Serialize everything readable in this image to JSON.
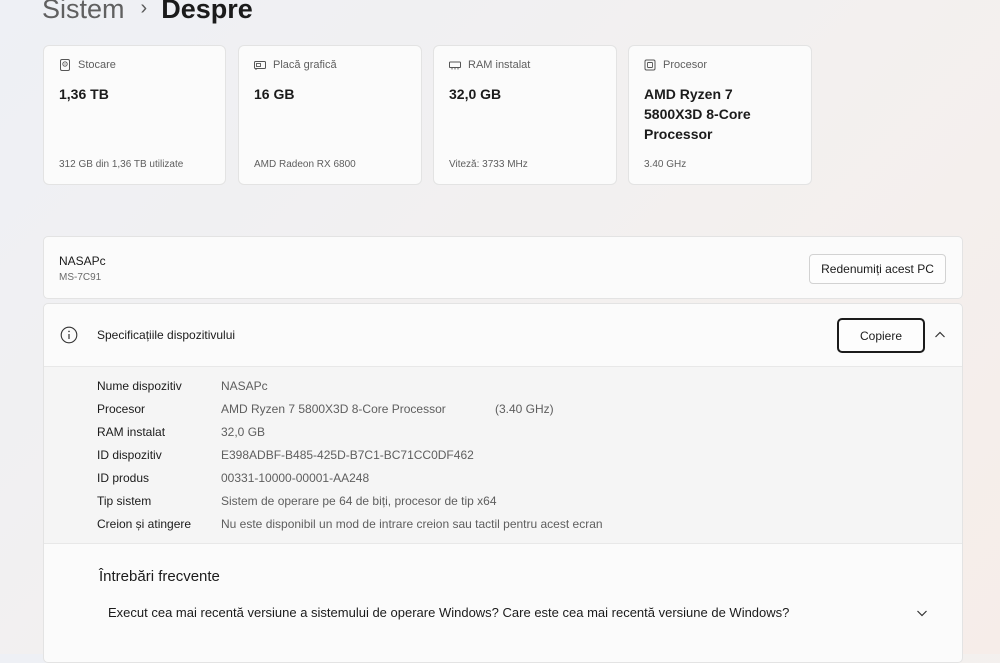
{
  "breadcrumb": {
    "parent": "Sistem",
    "separator": "›",
    "current": "Despre"
  },
  "cards": [
    {
      "icon": "storage-icon",
      "title": "Stocare",
      "value": "1,36 TB",
      "sub": "312 GB din 1,36 TB utilizate"
    },
    {
      "icon": "gpu-icon",
      "title": "Placă grafică",
      "value": "16 GB",
      "sub": "AMD Radeon RX 6800"
    },
    {
      "icon": "ram-icon",
      "title": "RAM instalat",
      "value": "32,0 GB",
      "sub": "Viteză: 3733 MHz"
    },
    {
      "icon": "processor-icon",
      "title": "Procesor",
      "value": "AMD Ryzen 7 5800X3D 8-Core Processor",
      "sub": "3.40 GHz"
    }
  ],
  "pc": {
    "name": "NASAPc",
    "model": "MS-7C91",
    "rename_label": "Redenumiți acest PC"
  },
  "specs": {
    "title": "Specificațiile dispozitivului",
    "copy_label": "Copiere",
    "rows": [
      {
        "label": "Nume dispozitiv",
        "value": "NASAPc"
      },
      {
        "label": "Procesor",
        "value": "AMD Ryzen 7 5800X3D 8-Core Processor",
        "extra": "(3.40 GHz)"
      },
      {
        "label": "RAM instalat",
        "value": "32,0 GB"
      },
      {
        "label": "ID dispozitiv",
        "value": "E398ADBF-B485-425D-B7C1-BC71CC0DF462"
      },
      {
        "label": "ID produs",
        "value": "00331-10000-00001-AA248"
      },
      {
        "label": "Tip sistem",
        "value": "Sistem de operare pe 64 de biți, procesor de tip x64"
      },
      {
        "label": "Creion și atingere",
        "value": "Nu este disponibil un mod de intrare creion sau tactil pentru acest ecran"
      }
    ]
  },
  "faq": {
    "title": "Întrebări frecvente",
    "question": "Execut cea mai recentă versiune a sistemului de operare Windows? Care este cea mai recentă versiune de Windows?"
  }
}
